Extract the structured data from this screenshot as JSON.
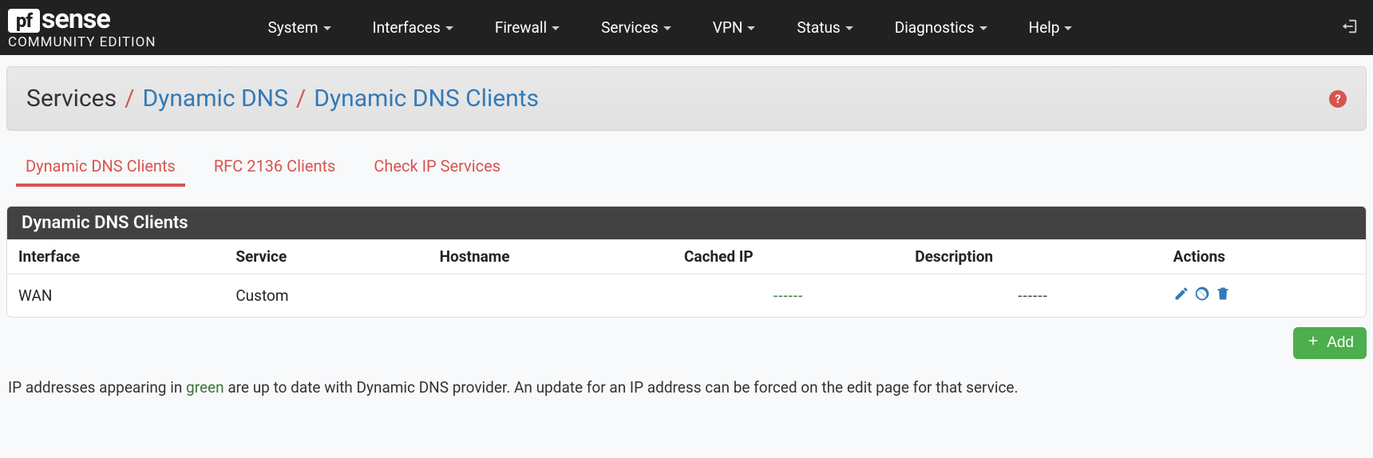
{
  "brand": {
    "logo_pf": "pf",
    "logo_sense": "sense",
    "edition": "COMMUNITY EDITION"
  },
  "nav": {
    "items": [
      {
        "label": "System"
      },
      {
        "label": "Interfaces"
      },
      {
        "label": "Firewall"
      },
      {
        "label": "Services"
      },
      {
        "label": "VPN"
      },
      {
        "label": "Status"
      },
      {
        "label": "Diagnostics"
      },
      {
        "label": "Help"
      }
    ]
  },
  "breadcrumb": {
    "root": "Services",
    "mid": "Dynamic DNS",
    "leaf": "Dynamic DNS Clients"
  },
  "tabs": [
    {
      "label": "Dynamic DNS Clients",
      "active": true
    },
    {
      "label": "RFC 2136 Clients",
      "active": false
    },
    {
      "label": "Check IP Services",
      "active": false
    }
  ],
  "panel_title": "Dynamic DNS Clients",
  "columns": {
    "interface": "Interface",
    "service": "Service",
    "hostname": "Hostname",
    "cached_ip": "Cached IP",
    "description": "Description",
    "actions": "Actions"
  },
  "rows": [
    {
      "interface": "WAN",
      "service": "Custom",
      "hostname": "",
      "cached_ip": "------",
      "description": "------"
    }
  ],
  "buttons": {
    "add": "Add"
  },
  "hint": {
    "pre": "IP addresses appearing in ",
    "green": "green",
    "post": " are up to date with Dynamic DNS provider. An update for an IP address can be forced on the edit page for that service."
  },
  "colors": {
    "link": "#337ab7",
    "danger": "#d9534f",
    "success": "#4cae4c",
    "ok_text": "#3c763d"
  }
}
